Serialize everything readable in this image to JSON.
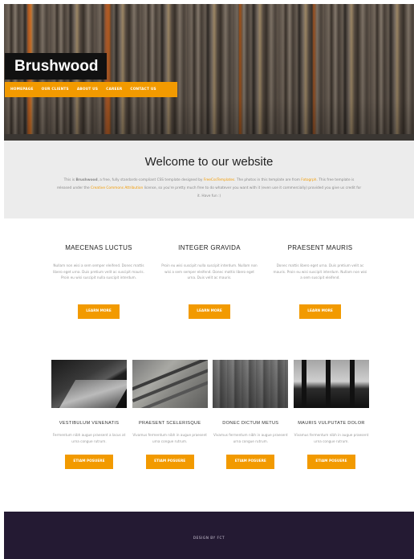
{
  "site": {
    "logo": "Brushwood"
  },
  "nav": [
    "HOMEPAGE",
    "OUR CLIENTS",
    "ABOUT US",
    "CAREER",
    "CONTACT US"
  ],
  "welcome": {
    "title": "Welcome to our website",
    "text_before_brand": "This is ",
    "brand": "Brushwood",
    "text_1": ", a free, fully standards-compliant CSS template designed by ",
    "link_1": "FreeCssTemplates",
    "text_2": ". The photos in this template are from ",
    "link_2": "Fotogrph",
    "text_3": ". This free template is released under the ",
    "link_3": "Creative Commons Attribution",
    "text_4": " license, so you're pretty much free to do whatever you want with it (even use it commercially) provided you give us credit for it. Have fun :)"
  },
  "features": [
    {
      "title": "MAECENAS LUCTUS",
      "text": "Nullam non wisi a sem semper eleifend. Donec mattis libero eget urna. Duis pretium velit ac suscipit mauris. Proin eu wisi suscipit nulla suscipit interdum.",
      "button": "LEARN MORE"
    },
    {
      "title": "INTEGER GRAVIDA",
      "text": "Proin eu wisi suscipit nulla suscipit interdum. Nullam non wisi a sem semper eleifend. Donec mattis libero eget urna. Duis velit ac mauris.",
      "button": "LEARN MORE"
    },
    {
      "title": "PRAESENT MAURIS",
      "text": "Donec mattis libero eget urna. Duis pretium velit ac mauris. Proin eu wisi suscipit interdum. Nullam non wisi a sem suscipit eleifend.",
      "button": "LEARN MORE"
    }
  ],
  "gallery": [
    {
      "title": "VESTIBULUM VENENATIS",
      "text": "Fermentum nibh augue praesent a lacus at urna congue rutrum.",
      "button": "ETIAM POSUERE",
      "image": "dark-tunnel-photo"
    },
    {
      "title": "PRAESENT SCELERISQUE",
      "text": "Vivamus fermentum nibh in augue praesent urna congue rutrum.",
      "button": "ETIAM POSUERE",
      "image": "concrete-stairs-photo"
    },
    {
      "title": "DONEC DICTUM METUS",
      "text": "Vivamus fermentum nibh in augue praesent urna congue rutrum.",
      "button": "ETIAM POSUERE",
      "image": "brick-wall-photo"
    },
    {
      "title": "MAURIS VULPUTATE DOLOR",
      "text": "Vivamus fermentum nibh in augue praesent urna congue rutrum.",
      "button": "ETIAM POSUERE",
      "image": "dark-pillars-photo"
    }
  ],
  "footer": {
    "text": "DESIGN BY FCT"
  },
  "colors": {
    "accent": "#f29a00",
    "footer_bg": "#241a33",
    "band_bg": "#ececec"
  }
}
